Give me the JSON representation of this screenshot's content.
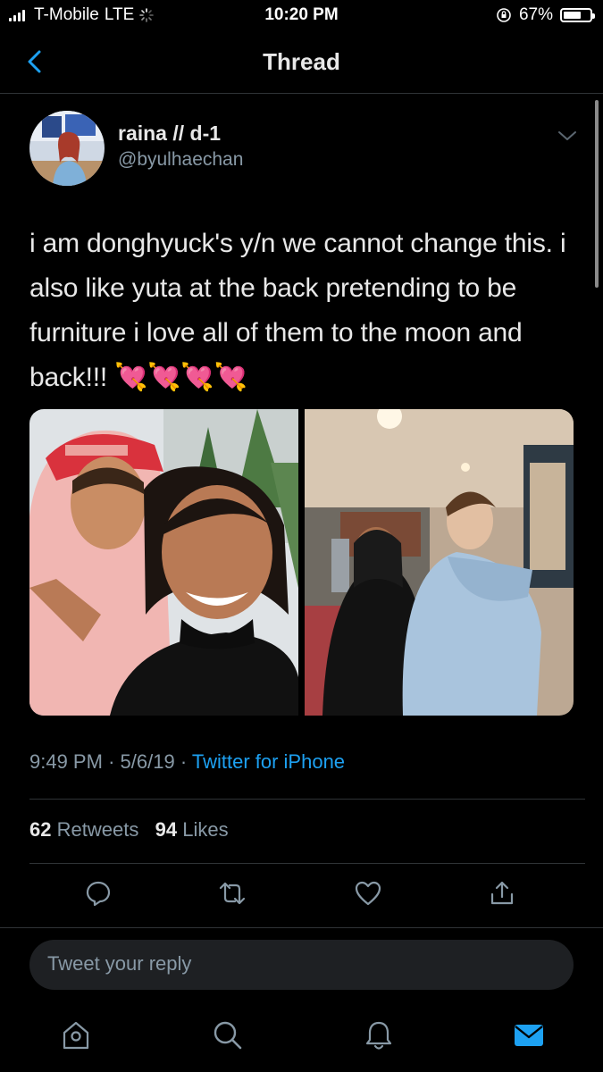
{
  "status_bar": {
    "carrier": "T-Mobile",
    "network": "LTE",
    "time": "10:20 PM",
    "battery_percent": "67%",
    "battery_level": 0.67
  },
  "nav": {
    "title": "Thread",
    "back_icon": "chevron-left-icon"
  },
  "tweet": {
    "author_name": "raina // d-1",
    "author_handle": "@byulhaechan",
    "text": "i am donghyuck's y/n we cannot change this. i also like yuta at the back pretending to be furniture i love all of them to the moon and back!!! 💘💘💘💘",
    "photo_count": 2,
    "time": "9:49 PM",
    "date": "5/6/19",
    "source": "Twitter for iPhone",
    "retweets_count": "62",
    "retweets_label": "Retweets",
    "likes_count": "94",
    "likes_label": "Likes",
    "separator": "·"
  },
  "actions": [
    "reply-icon",
    "retweet-icon",
    "like-icon",
    "share-icon"
  ],
  "reply_box": {
    "placeholder": "Tweet your reply"
  },
  "tab_bar": [
    "home-icon",
    "search-icon",
    "notifications-icon",
    "messages-icon"
  ],
  "colors": {
    "background": "#000000",
    "accent": "#1da1f2",
    "secondary_text": "#8899a6",
    "divider": "#2f3336"
  }
}
